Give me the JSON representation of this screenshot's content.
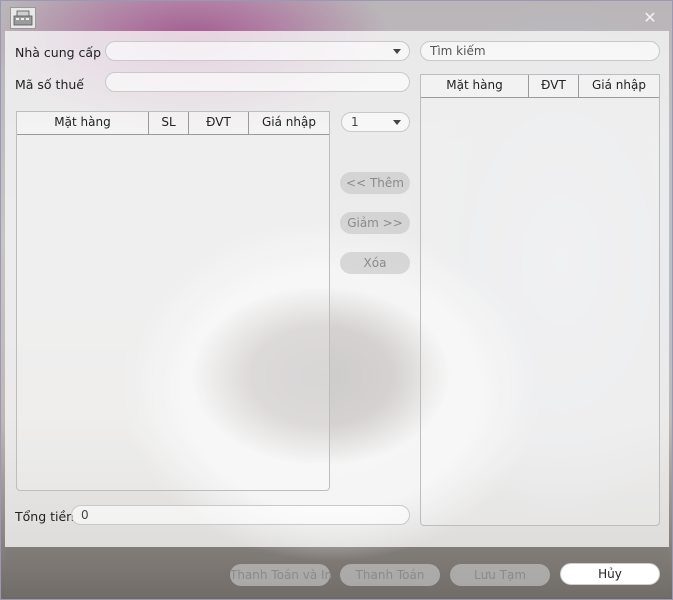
{
  "window": {
    "close_symbol": "✕",
    "logo_icon": "cash-register-icon"
  },
  "form": {
    "supplier_label": "Nhà cung cấp",
    "supplier_value": "",
    "tax_label": "Mã số thuế",
    "tax_value": "",
    "quantity_value": "1",
    "total_label": "Tổng tiền",
    "total_value": "0"
  },
  "search": {
    "placeholder": "Tìm kiếm"
  },
  "left_table": {
    "columns": [
      "Mặt hàng",
      "SL",
      "ĐVT",
      "Giá nhập"
    ],
    "rows": []
  },
  "right_table": {
    "columns": [
      "Mặt hàng",
      "ĐVT",
      "Giá nhập"
    ],
    "rows": []
  },
  "actions": {
    "add_label": "<< Thêm",
    "decrease_label": "Giảm >>",
    "delete_label": "Xóa"
  },
  "footer": {
    "pay_print_label": "Thanh Toán và In",
    "pay_label": "Thanh Toán",
    "save_draft_label": "Lưu Tạm",
    "cancel_label": "Hủy"
  },
  "colors": {
    "overlay": "#f7f7f7",
    "border": "#9a98b5",
    "disabled_button": "#c8c8c8",
    "disabled_text": "#8a8a8a"
  }
}
